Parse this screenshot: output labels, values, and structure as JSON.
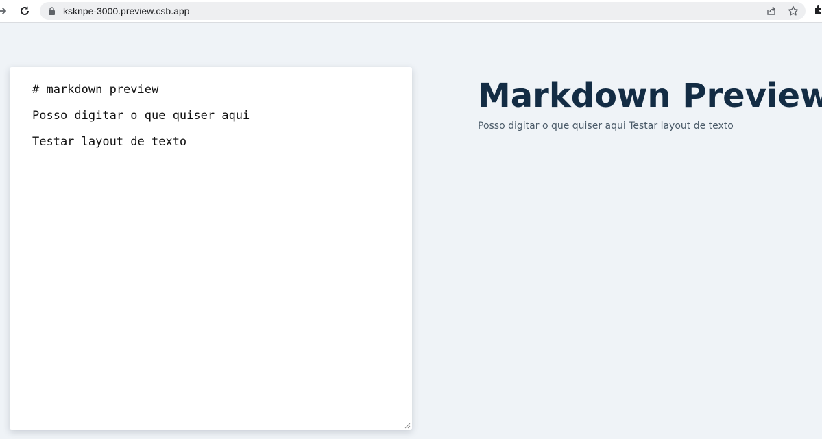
{
  "browser": {
    "url": "ksknpe-3000.preview.csb.app",
    "icons": {
      "forward": "forward-arrow-icon",
      "reload": "reload-icon",
      "lock": "lock-icon",
      "share": "share-icon",
      "bookmark": "star-icon",
      "extensions": "puzzle-icon"
    }
  },
  "editor": {
    "lines": [
      "# markdown preview",
      "Posso digitar o que quiser aqui",
      "Testar layout de texto"
    ]
  },
  "preview": {
    "title": "Markdown Preview",
    "paragraph": "Posso digitar o que quiser aqui Testar layout de texto"
  },
  "colors": {
    "page_background": "#eff3f7",
    "title_color": "#132c44",
    "text_color": "#4a5a68"
  }
}
